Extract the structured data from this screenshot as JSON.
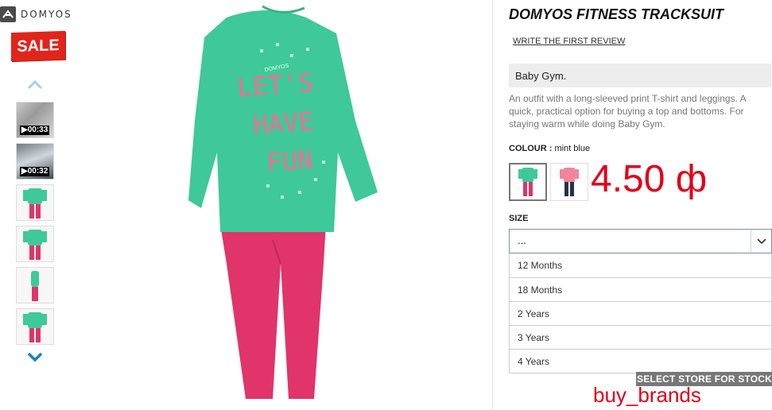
{
  "brand": {
    "name": "DOMYOS",
    "logo_icon": "domyos-logo-icon"
  },
  "sale_badge": "SALE",
  "gallery": {
    "up_icon": "chevron-up-icon",
    "down_icon": "chevron-down-icon",
    "thumbnails": [
      {
        "type": "video",
        "label": "▶00:33"
      },
      {
        "type": "video",
        "label": "▶00:32"
      },
      {
        "type": "image"
      },
      {
        "type": "image"
      },
      {
        "type": "image"
      },
      {
        "type": "image"
      }
    ]
  },
  "hero_image": {
    "print_text": [
      "LET'S",
      "HAVE",
      "FUN"
    ],
    "small_brand": "DOMYOS"
  },
  "product": {
    "title": "DOMYOS FITNESS TRACKSUIT",
    "review_link": "WRITE THE FIRST REVIEW",
    "subtitle": "Baby Gym.",
    "description": "An outfit with a long-sleeved print T-shirt and leggings. A quick, practical option for buying a top and bottoms. For staying warm while doing Baby Gym.",
    "colour_label": "COLOUR :",
    "colour_value": "mint blue",
    "price": "4.50 ф",
    "size_label": "SIZE",
    "size_selected": "...",
    "size_options": [
      "12 Months",
      "18 Months",
      "2 Years",
      "3 Years",
      "4 Years"
    ],
    "store_button": "SELECT STORE FOR STOCK",
    "watermark": "buy_brands"
  },
  "colors": {
    "sale_red": "#e1251b",
    "price_red": "#e0001a",
    "mint": "#3fc89a",
    "pink": "#e0346b"
  }
}
